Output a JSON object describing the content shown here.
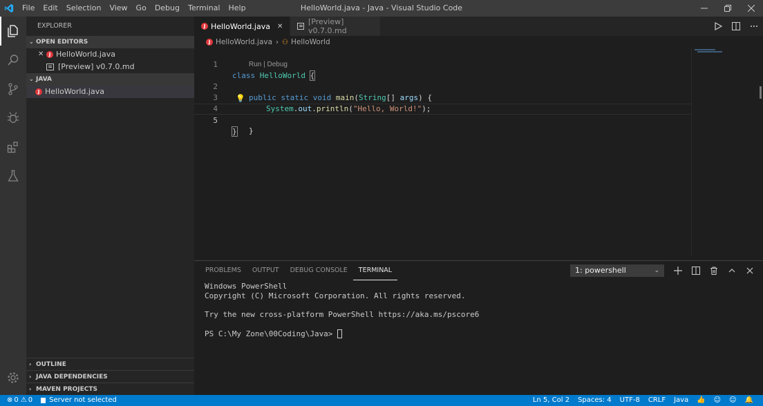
{
  "titlebar": {
    "menu": [
      "File",
      "Edit",
      "Selection",
      "View",
      "Go",
      "Debug",
      "Terminal",
      "Help"
    ],
    "title": "HelloWorld.java - Java - Visual Studio Code"
  },
  "activity_bar": {
    "items": [
      "explorer-icon",
      "search-icon",
      "source-control-icon",
      "debug-icon",
      "extensions-icon",
      "test-icon"
    ],
    "bottom": "gear-icon"
  },
  "sidebar": {
    "title": "EXPLORER",
    "open_editors": {
      "header": "OPEN EDITORS",
      "items": [
        "HelloWorld.java",
        "[Preview] v0.7.0.md"
      ]
    },
    "java": {
      "header": "JAVA",
      "items": [
        "HelloWorld.java"
      ]
    },
    "bottom_sections": [
      "OUTLINE",
      "JAVA DEPENDENCIES",
      "MAVEN PROJECTS"
    ]
  },
  "tabs": [
    {
      "label": "HelloWorld.java",
      "active": true
    },
    {
      "label": "[Preview] v0.7.0.md",
      "active": false
    }
  ],
  "breadcrumb": {
    "file": "HelloWorld.java",
    "symbol": "HelloWorld"
  },
  "editor": {
    "line_numbers": [
      "1",
      "2",
      "3",
      "4",
      "5"
    ],
    "codelens": "Run | Debug",
    "lines": [
      "class HelloWorld {",
      "public static void main(String[] args) {",
      "System.out.println(\"Hello, World!\");",
      "}",
      "}"
    ]
  },
  "panel": {
    "tabs": [
      "PROBLEMS",
      "OUTPUT",
      "DEBUG CONSOLE",
      "TERMINAL"
    ],
    "active_tab": "TERMINAL",
    "terminal_select": "1: powershell",
    "terminal_lines": [
      "Windows PowerShell",
      "Copyright (C) Microsoft Corporation. All rights reserved.",
      "",
      "Try the new cross-platform PowerShell https://aka.ms/pscore6",
      "",
      "PS C:\\My Zone\\00Coding\\Java> "
    ]
  },
  "statusbar": {
    "errors": "0",
    "warnings": "0",
    "server": "Server not selected",
    "position": "Ln 5, Col 2",
    "spaces": "Spaces: 4",
    "encoding": "UTF-8",
    "eol": "CRLF",
    "language": "Java"
  },
  "colors": {
    "accent": "#007acc",
    "java_badge": "#e0393e"
  }
}
